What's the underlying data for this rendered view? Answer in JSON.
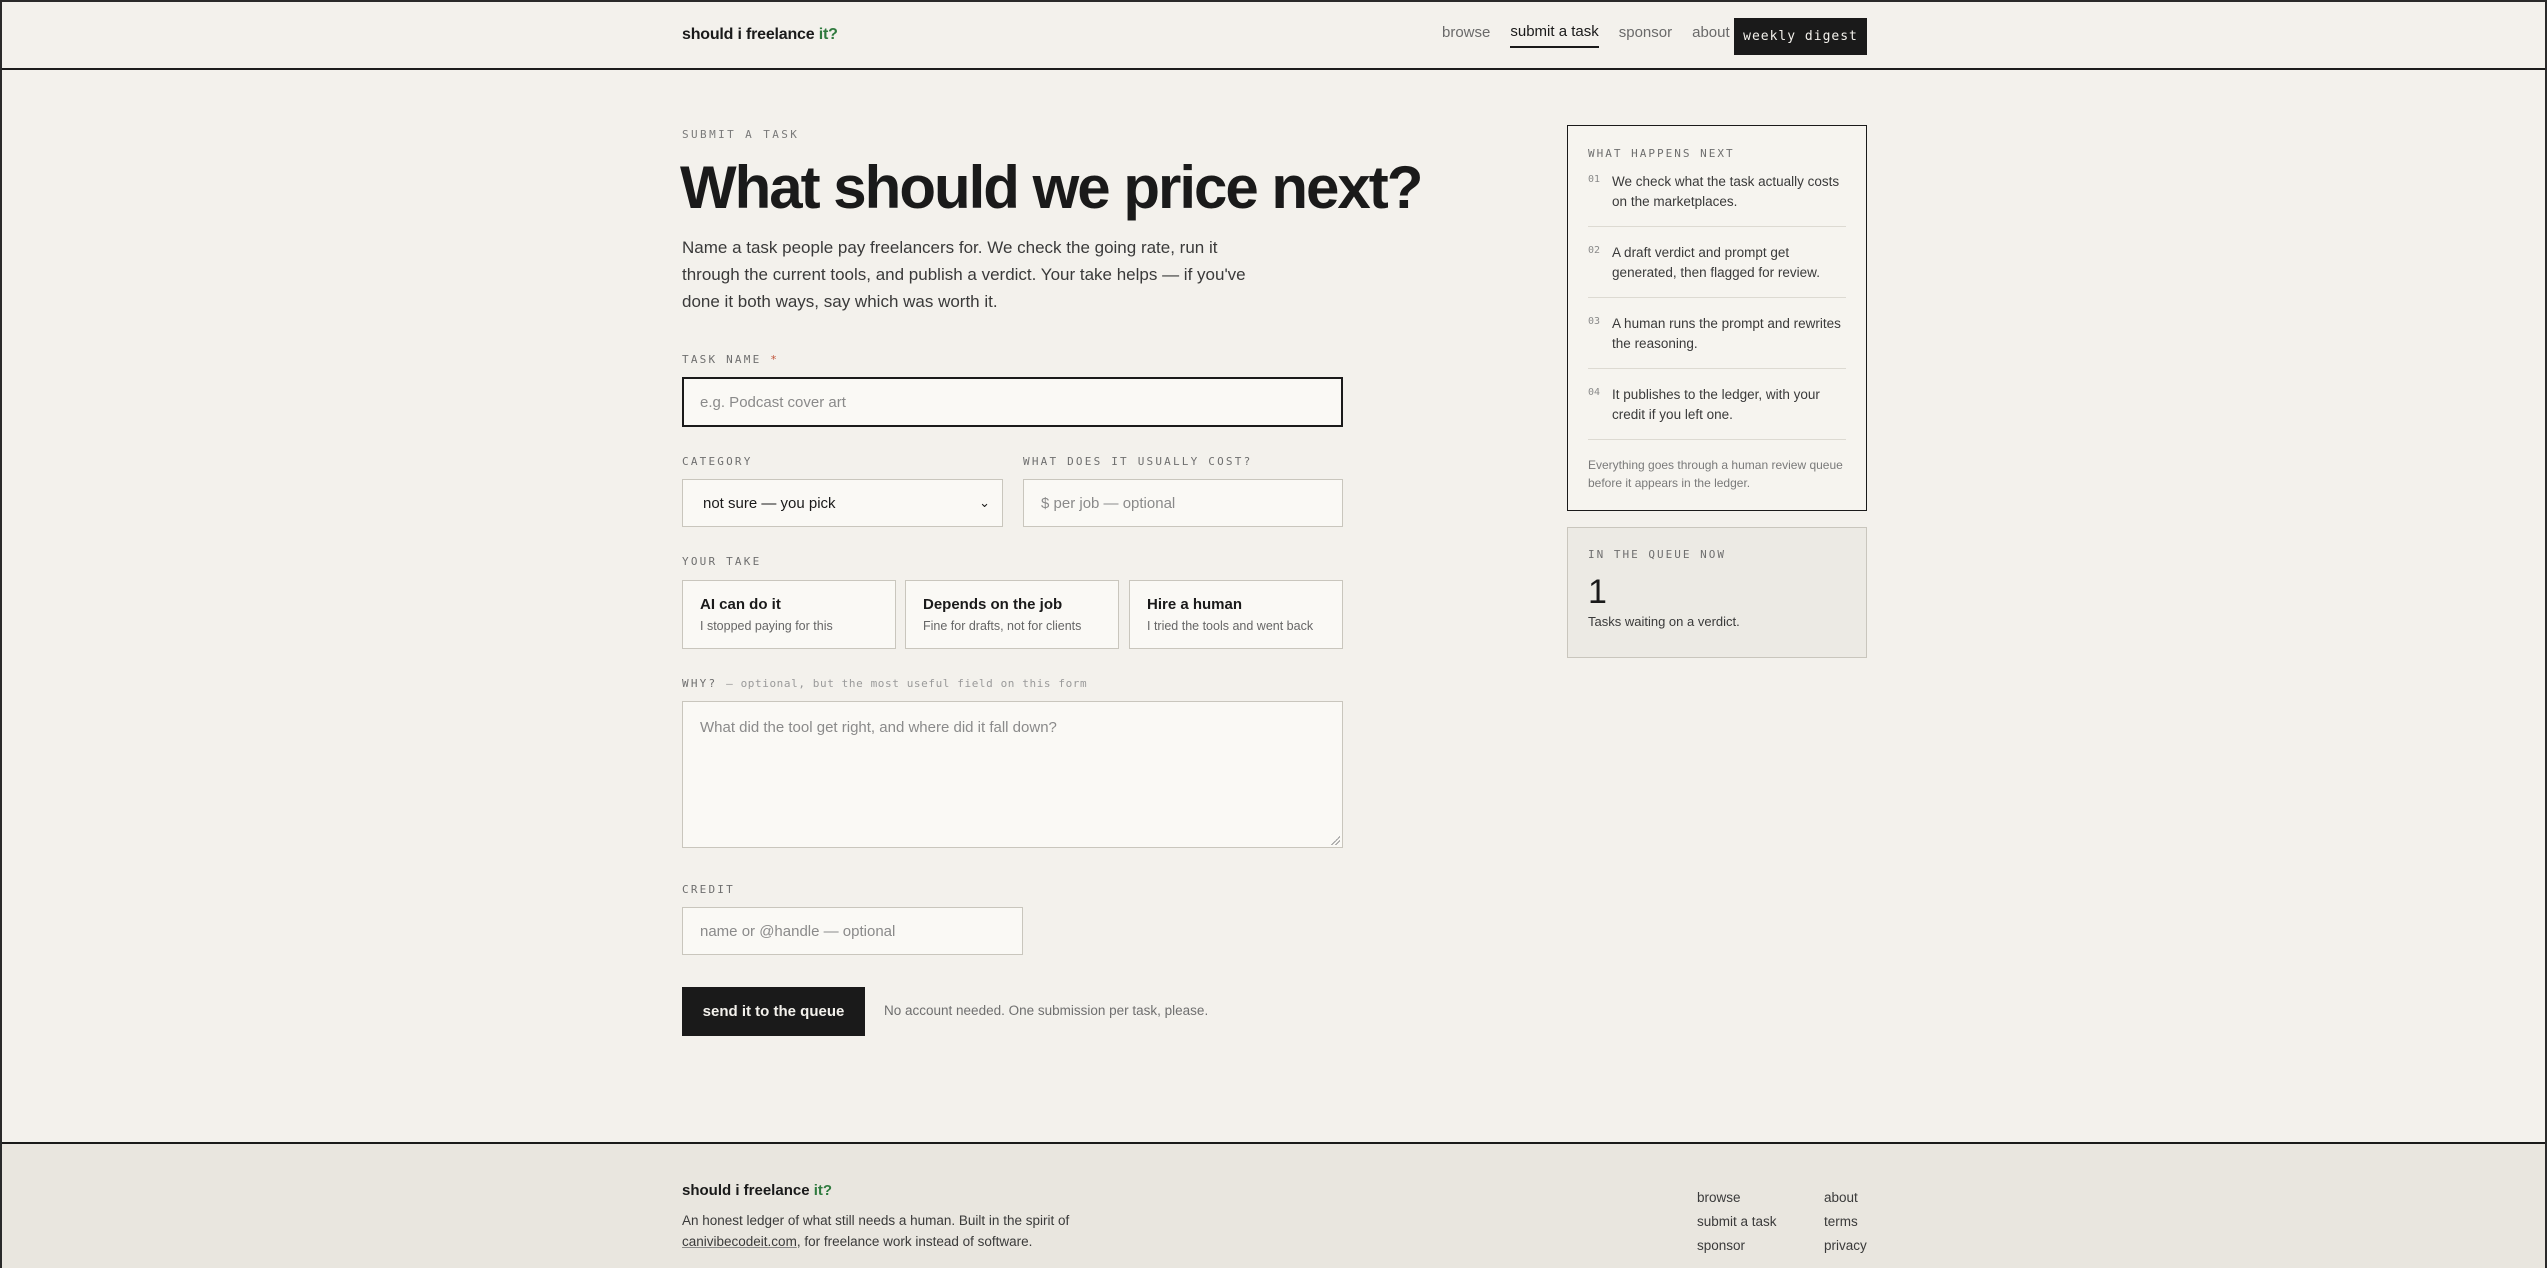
{
  "header": {
    "logo_main": "should i freelance",
    "logo_accent": "it?",
    "nav": [
      "browse",
      "submit a task",
      "sponsor",
      "about"
    ],
    "digest_button": "weekly digest"
  },
  "main": {
    "eyebrow": "SUBMIT A TASK",
    "headline": "What should we price next?",
    "intro": "Name a task people pay freelancers for. We check the going rate, run it through the current tools, and publish a verdict. Your take helps — if you've done it both ways, say which was worth it.",
    "task_name_label": "TASK NAME",
    "required_mark": "*",
    "task_name_placeholder": "e.g. Podcast cover art",
    "category_label": "CATEGORY",
    "category_value": "not sure — you pick",
    "cost_label": "WHAT DOES IT USUALLY COST?",
    "cost_placeholder": "$ per job — optional",
    "take_label": "YOUR TAKE",
    "takes": [
      {
        "title": "AI can do it",
        "sub": "I stopped paying for this"
      },
      {
        "title": "Depends on the job",
        "sub": "Fine for drafts, not for clients"
      },
      {
        "title": "Hire a human",
        "sub": "I tried the tools and went back"
      }
    ],
    "why_label": "WHY?",
    "why_hint": "— optional, but the most useful field on this form",
    "why_placeholder": "What did the tool get right, and where did it fall down?",
    "credit_label": "CREDIT",
    "credit_placeholder": "name or @handle — optional",
    "submit_button": "send it to the queue",
    "submit_note": "No account needed. One submission per task, please."
  },
  "sidebar": {
    "steps_label": "WHAT HAPPENS NEXT",
    "steps": [
      {
        "n": "01",
        "text": "We check what the task actually costs on the marketplaces."
      },
      {
        "n": "02",
        "text": "A draft verdict and prompt get generated, then flagged for review."
      },
      {
        "n": "03",
        "text": "A human runs the prompt and rewrites the reasoning."
      },
      {
        "n": "04",
        "text": "It publishes to the ledger, with your credit if you left one."
      }
    ],
    "steps_foot": "Everything goes through a human review queue before it appears in the ledger.",
    "queue_label": "IN THE QUEUE NOW",
    "queue_count": "1",
    "queue_sub": "Tasks waiting on a verdict."
  },
  "footer": {
    "logo_main": "should i freelance",
    "logo_accent": "it?",
    "desc_before": "An honest ledger of what still needs a human. Built in the spirit of ",
    "desc_link": "canivibecodeit.com",
    "desc_after": ", for freelance work instead of software.",
    "col1": [
      "browse",
      "submit a task",
      "sponsor"
    ],
    "col2": [
      "about",
      "terms",
      "privacy"
    ]
  },
  "colors": {
    "background": "#f3f1ec",
    "ink": "#1a1a1a",
    "accent_green": "#2f7a3e",
    "required_red": "#c0533a"
  }
}
